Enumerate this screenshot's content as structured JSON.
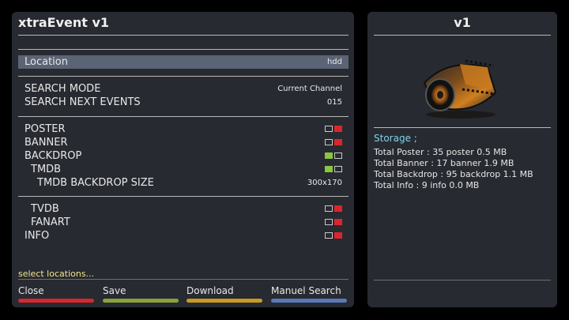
{
  "left_panel": {
    "title": "xtraEvent v1",
    "rows": [
      {
        "label": "Location",
        "value": "hdd"
      },
      {
        "label": "SEARCH MODE",
        "value": "Current Channel"
      },
      {
        "label": "SEARCH NEXT EVENTS",
        "value": "015"
      },
      {
        "label": "POSTER",
        "toggle": "off"
      },
      {
        "label": "BANNER",
        "toggle": "off"
      },
      {
        "label": "BACKDROP",
        "toggle": "on"
      },
      {
        "label": "TMDB",
        "toggle": "on"
      },
      {
        "label": "TMDB BACKDROP SIZE",
        "value": "300x170"
      },
      {
        "label": "TVDB",
        "toggle": "off"
      },
      {
        "label": "FANART",
        "toggle": "off"
      },
      {
        "label": "INFO",
        "toggle": "off"
      }
    ],
    "status": "select locations...",
    "keys": [
      {
        "label": "Close",
        "color": "#d9262c"
      },
      {
        "label": "Save",
        "color": "#8ba33a"
      },
      {
        "label": "Download",
        "color": "#c99a22"
      },
      {
        "label": "Manuel Search",
        "color": "#5b78b8"
      }
    ]
  },
  "right_panel": {
    "title": "v1",
    "storage_title": "Storage ;",
    "lines": [
      "Total Poster : 35 poster 0.5 MB",
      "Total Banner : 17 banner 1.9 MB",
      "Total Backdrop : 95 backdrop 1.1 MB",
      "Total Info : 9 info 0.0 MB"
    ],
    "image_icon": "film-reel-icon"
  },
  "colors": {
    "panel_bg": "#282a31",
    "selected_row": "#5b6475",
    "toggle_on": "#8cc63f",
    "toggle_off": "#d9262c",
    "status_text": "#f0e68c",
    "storage_title": "#7fd3e6"
  }
}
